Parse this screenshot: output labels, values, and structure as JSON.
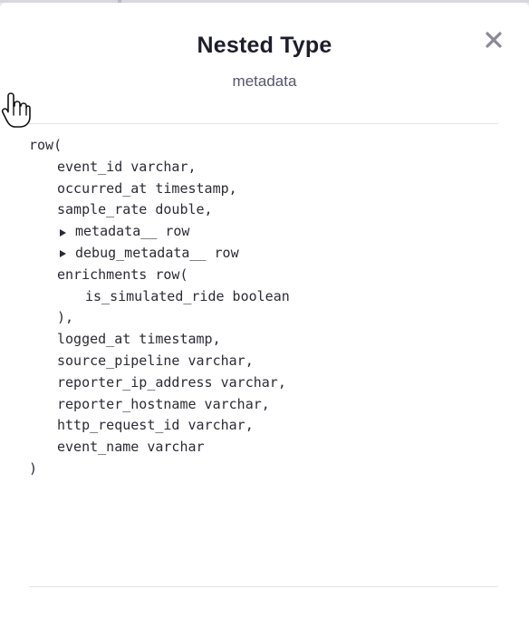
{
  "modal": {
    "title": "Nested Type",
    "subtitle": "metadata",
    "close_icon": "close-icon"
  },
  "schema": {
    "lines": [
      {
        "text": "row(",
        "indent": 0,
        "expandable": false
      },
      {
        "text": "event_id varchar,",
        "indent": 1,
        "expandable": false
      },
      {
        "text": "occurred_at timestamp,",
        "indent": 1,
        "expandable": false
      },
      {
        "text": "sample_rate double,",
        "indent": 1,
        "expandable": false
      },
      {
        "text": "metadata__ row",
        "indent": 1,
        "expandable": true
      },
      {
        "text": "debug_metadata__ row",
        "indent": 1,
        "expandable": true
      },
      {
        "text": "enrichments row(",
        "indent": 1,
        "expandable": false
      },
      {
        "text": "is_simulated_ride boolean",
        "indent": 2,
        "expandable": false
      },
      {
        "text": "),",
        "indent": 1,
        "expandable": false
      },
      {
        "text": "logged_at timestamp,",
        "indent": 1,
        "expandable": false
      },
      {
        "text": "source_pipeline varchar,",
        "indent": 1,
        "expandable": false
      },
      {
        "text": "reporter_ip_address varchar,",
        "indent": 1,
        "expandable": false
      },
      {
        "text": "reporter_hostname varchar,",
        "indent": 1,
        "expandable": false
      },
      {
        "text": "http_request_id varchar,",
        "indent": 1,
        "expandable": false
      },
      {
        "text": "event_name varchar",
        "indent": 1,
        "expandable": false
      },
      {
        "text": ")",
        "indent": 0,
        "expandable": false
      }
    ]
  },
  "icons": {
    "expand": "caret-right-icon",
    "cursor": "hand-pointer-cursor-icon"
  },
  "colors": {
    "title": "#1d1d2c",
    "subtitle": "#55566a",
    "code": "#2b2b36",
    "close": "#8a8a96",
    "divider": "#e3e3e8"
  }
}
